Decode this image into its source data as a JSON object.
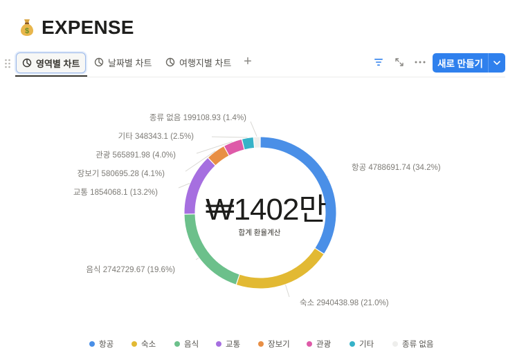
{
  "page": {
    "title": "EXPENSE",
    "icon": "money-bag-icon"
  },
  "toolbar": {
    "tabs": [
      {
        "label": "영역별 차트",
        "icon": "pie-chart-icon",
        "active": true
      },
      {
        "label": "날짜별 차트",
        "icon": "pie-chart-icon",
        "active": false
      },
      {
        "label": "여행지별 차트",
        "icon": "pie-chart-icon",
        "active": false
      }
    ],
    "add_view_label": "+",
    "new_button_label": "새로 만들기"
  },
  "chart_data": {
    "type": "pie",
    "style": "donut",
    "center_value": "₩1402만",
    "center_caption": "합계 환율계산",
    "slices": [
      {
        "name": "항공",
        "value": 4788691.74,
        "percent": "34.2%",
        "color": "#4a8fe7"
      },
      {
        "name": "숙소",
        "value": 2940438.98,
        "percent": "21.0%",
        "color": "#e2b933"
      },
      {
        "name": "음식",
        "value": 2742729.67,
        "percent": "19.6%",
        "color": "#6cc08b"
      },
      {
        "name": "교통",
        "value": 1854068.1,
        "percent": "13.2%",
        "color": "#a66fe0"
      },
      {
        "name": "장보기",
        "value": 580695.28,
        "percent": "4.1%",
        "color": "#e88f45"
      },
      {
        "name": "관광",
        "value": 565891.98,
        "percent": "4.0%",
        "color": "#de5aa8"
      },
      {
        "name": "기타",
        "value": 348343.1,
        "percent": "2.5%",
        "color": "#36b2c8"
      },
      {
        "name": "종류 없음",
        "value": 199108.93,
        "percent": "1.4%",
        "color": "#eeeeec"
      }
    ],
    "labels": [
      "항공 4788691.74 (34.2%)",
      "숙소 2940438.98 (21.0%)",
      "음식 2742729.67 (19.6%)",
      "교통 1854068.1 (13.2%)",
      "장보기 580695.28 (4.1%)",
      "관광 565891.98 (4.0%)",
      "기타 348343.1 (2.5%)",
      "종류 없음 199108.93 (1.4%)"
    ],
    "legend": {
      "position": "bottom",
      "items": [
        "항공",
        "숙소",
        "음식",
        "교통",
        "장보기",
        "관광",
        "기타",
        "종류 없음"
      ]
    }
  }
}
